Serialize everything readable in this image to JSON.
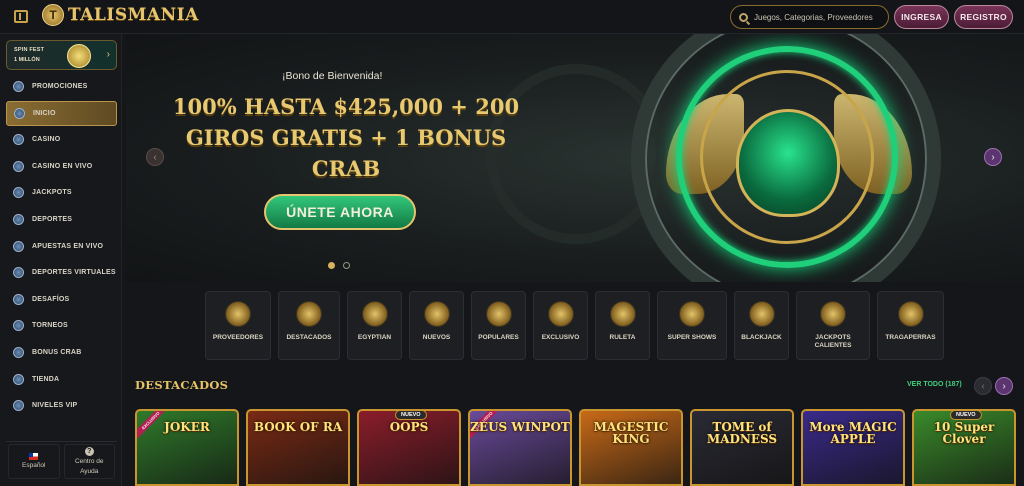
{
  "header": {
    "logo_text": "TALISMANIA",
    "logo_badge": "T",
    "search_placeholder": "Juegos, Categorias, Proveedores",
    "login_label": "INGRESA",
    "register_label": "REGISTRO"
  },
  "sidebar": {
    "promo_line1": "SPIN FEST",
    "promo_line2": "1 MILLÓN",
    "promo_arrow": "›",
    "items": [
      {
        "label": "PROMOCIONES",
        "active": false
      },
      {
        "label": "INICIO",
        "active": true
      },
      {
        "label": "CASINO",
        "active": false
      },
      {
        "label": "CASINO EN VIVO",
        "active": false
      },
      {
        "label": "JACKPOTS",
        "active": false
      },
      {
        "label": "DEPORTES",
        "active": false
      },
      {
        "label": "APUESTAS EN VIVO",
        "active": false
      },
      {
        "label": "DEPORTES VIRTUALES",
        "active": false
      },
      {
        "label": "DESAFÍOS",
        "active": false
      },
      {
        "label": "TORNEOS",
        "active": false
      },
      {
        "label": "BONUS CRAB",
        "active": false
      },
      {
        "label": "TIENDA",
        "active": false
      },
      {
        "label": "NIVELES VIP",
        "active": false
      }
    ],
    "language_label": "Español",
    "help_label_1": "Centro de",
    "help_label_2": "Ayuda",
    "help_icon_char": "?"
  },
  "hero": {
    "subtitle": "¡Bono de Bienvenida!",
    "title_line1": "100% HASTA $425,000 + 200",
    "title_line2": "GIROS GRATIS + 1 BONUS",
    "title_line3": "CRAB",
    "cta_label": "ÚNETE AHORA",
    "slides": 2,
    "active_slide": 1,
    "prev_char": "‹",
    "next_char": "›"
  },
  "categories": [
    {
      "label": "PROVEEDORES",
      "icon": "scroll-icon"
    },
    {
      "label": "DESTACADOS",
      "icon": "scarab-icon"
    },
    {
      "label": "EGYPTIAN",
      "icon": "eye-of-horus-icon"
    },
    {
      "label": "NUEVOS",
      "icon": "sun-icon"
    },
    {
      "label": "POPULARES",
      "icon": "crown-icon"
    },
    {
      "label": "EXCLUSIVO",
      "icon": "pharaoh-icon"
    },
    {
      "label": "RULETA",
      "icon": "roulette-icon"
    },
    {
      "label": "SUPER SHOWS",
      "icon": "show-icon"
    },
    {
      "label": "BLACKJACK",
      "icon": "spade-icon"
    },
    {
      "label": "JACKPOTS CALIENTES",
      "icon": "flame-icon"
    },
    {
      "label": "TRAGAPERRAS",
      "icon": "slot-machine-icon"
    }
  ],
  "featured": {
    "title": "DESTACADOS",
    "view_all": "VER TODO (187)",
    "prev_char": "‹",
    "next_char": "›",
    "games": [
      {
        "title": "JOKER",
        "badge": "",
        "corner": "EXCLUSIVO",
        "bg": "#2f7a2a"
      },
      {
        "title": "BOOK OF RA",
        "badge": "",
        "corner": "",
        "bg": "#7a2a14"
      },
      {
        "title": "OOPS",
        "badge": "NUEVO",
        "corner": "",
        "bg": "#8a1d2a"
      },
      {
        "title": "ZEUS WINPOT",
        "badge": "",
        "corner": "EXCLUSIVO",
        "bg": "#6a4a9a"
      },
      {
        "title": "MAGESTIC KING",
        "badge": "",
        "corner": "",
        "bg": "#c86a18"
      },
      {
        "title": "TOME of MADNESS",
        "badge": "",
        "corner": "",
        "bg": "#2a2a34"
      },
      {
        "title": "More MAGIC APPLE",
        "badge": "",
        "corner": "",
        "bg": "#3a2a8a"
      },
      {
        "title": "10 Super Clover",
        "badge": "NUEVO",
        "corner": "",
        "bg": "#3a8a2a"
      }
    ]
  }
}
